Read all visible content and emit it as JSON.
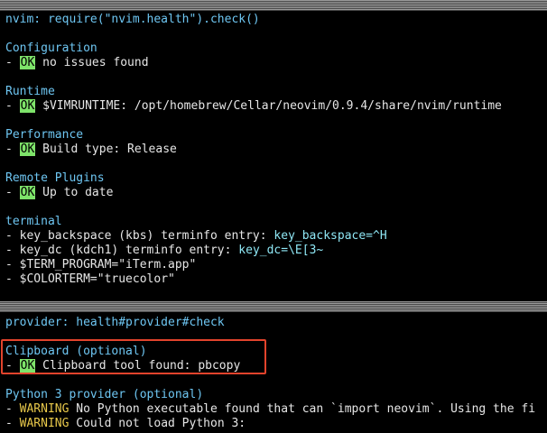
{
  "sections": [
    {
      "header": "nvim: require(\"nvim.health\").check()",
      "groups": [
        {
          "title": "Configuration",
          "items": [
            {
              "status": "OK",
              "text": "no issues found"
            }
          ]
        },
        {
          "title": "Runtime",
          "items": [
            {
              "status": "OK",
              "text": "$VIMRUNTIME: /opt/homebrew/Cellar/neovim/0.9.4/share/nvim/runtime"
            }
          ]
        },
        {
          "title": "Performance",
          "items": [
            {
              "status": "OK",
              "text": "Build type: Release"
            }
          ]
        },
        {
          "title": "Remote Plugins",
          "items": [
            {
              "status": "OK",
              "text": "Up to date"
            }
          ]
        },
        {
          "title": "terminal",
          "items": [
            {
              "prefix": "key_backspace (kbs) terminfo entry: ",
              "value": "key_backspace=^H"
            },
            {
              "prefix": "key_dc (kdch1) terminfo entry: ",
              "value": "key_dc=\\E[3~"
            },
            {
              "prefix": "$TERM_PROGRAM=\"iTerm.app\""
            },
            {
              "prefix": "$COLORTERM=\"truecolor\""
            }
          ]
        }
      ]
    },
    {
      "header": "provider: health#provider#check",
      "groups": [
        {
          "title": "Clipboard (optional)",
          "items": [
            {
              "status": "OK",
              "text": "Clipboard tool found: pbcopy"
            }
          ]
        },
        {
          "title": "Python 3 provider (optional)",
          "items": [
            {
              "status": "WARNING",
              "text": "No Python executable found that can `import neovim`. Using the fi"
            },
            {
              "status": "WARNING",
              "text": "Could not load Python 3:"
            }
          ]
        }
      ]
    }
  ],
  "bullet": "- ",
  "colors": {
    "ok_bg": "#7ee36a",
    "heading": "#6ec6f2",
    "value": "#8fe7f5",
    "warning": "#e8c84a",
    "highlight_box": "#e2432c"
  }
}
